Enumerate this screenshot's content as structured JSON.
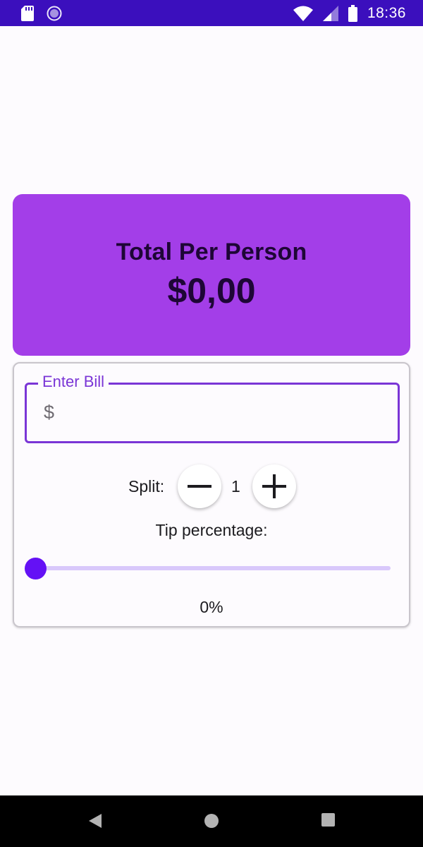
{
  "status_bar": {
    "time": "18:36",
    "icons": [
      "sd-card-icon",
      "loading-icon",
      "wifi-icon",
      "signal-icon",
      "battery-icon"
    ]
  },
  "total_card": {
    "title": "Total Per Person",
    "amount": "$0,00"
  },
  "bill": {
    "label": "Enter Bill",
    "prefix": "$",
    "value": "",
    "placeholder": ""
  },
  "split": {
    "label": "Split:",
    "count": "1",
    "minus_icon": "minus-icon",
    "plus_icon": "plus-icon"
  },
  "tip": {
    "label": "Tip percentage:",
    "percent": 0,
    "value_text": "0%"
  },
  "nav": {
    "icons": [
      "back-icon",
      "home-icon",
      "recents-icon"
    ]
  },
  "colors": {
    "status_bar": "#3b0fbd",
    "total_card": "#a33ee8",
    "accent": "#7a35d6",
    "slider": "#6411f5",
    "slider_track": "#d9c8fb"
  }
}
